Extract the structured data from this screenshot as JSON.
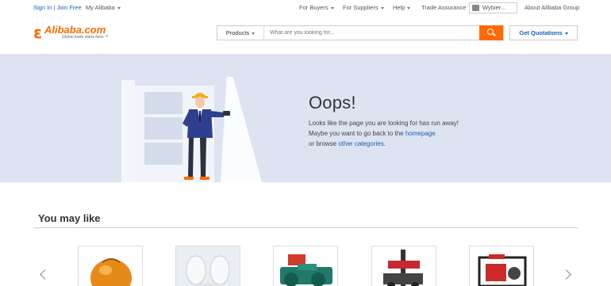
{
  "topbar": {
    "sign_in": "Sign In",
    "separator": "|",
    "join_free": "Join Free",
    "my_alibaba": "My Alibaba",
    "for_buyers": "For Buyers",
    "for_suppliers": "For Suppliers",
    "help": "Help",
    "trade_assurance": "Trade Assurance",
    "language": "Wybier...",
    "about": "About Alibaba Group"
  },
  "logo": {
    "name": "Alibaba.com",
    "tagline": "Global trade starts here.™"
  },
  "search": {
    "category": "Products",
    "placeholder": "What are you looking for..."
  },
  "get_quotations": "Get Quotations",
  "error": {
    "title": "Oops!",
    "line1": "Looks like the page you are looking for has run away!",
    "line2_prefix": "Maybe you want to go back to the",
    "homepage_link": "homepage",
    "line3_prefix": "or browse",
    "categories_link": "other categories",
    "line3_suffix": "."
  },
  "you_may_like": {
    "title": "You may like",
    "products": [
      {
        "icon": "orange-sphere-product"
      },
      {
        "icon": "white-powder-product"
      },
      {
        "icon": "briquette-machine-product"
      },
      {
        "icon": "red-drilling-rig-product"
      },
      {
        "icon": "water-pump-product"
      }
    ]
  },
  "colors": {
    "accent": "#ff6a00",
    "link": "#1a5fb4",
    "hero_bg": "#dde3f1"
  }
}
